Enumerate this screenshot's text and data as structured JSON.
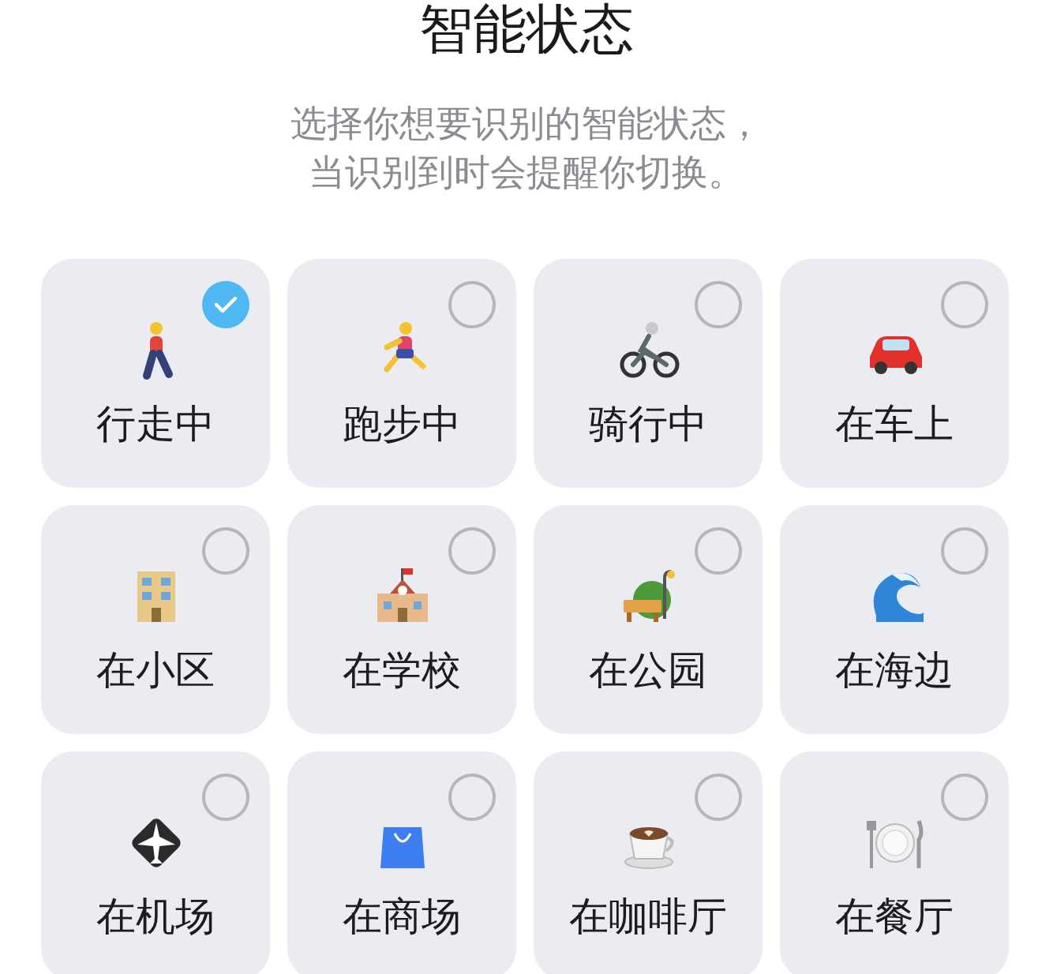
{
  "title": "智能状态",
  "subtitle": [
    "选择你想要识别的智能状态，",
    "当识别到时会提醒你切换。"
  ],
  "states": [
    {
      "label": "行走中",
      "selected": true
    },
    {
      "label": "跑步中",
      "selected": false
    },
    {
      "label": "骑行中",
      "selected": false
    },
    {
      "label": "在车上",
      "selected": false
    },
    {
      "label": "在小区",
      "selected": false
    },
    {
      "label": "在学校",
      "selected": false
    },
    {
      "label": "在公园",
      "selected": false
    },
    {
      "label": "在海边",
      "selected": false
    },
    {
      "label": "在机场",
      "selected": false
    },
    {
      "label": "在商场",
      "selected": false
    },
    {
      "label": "在咖啡厅",
      "selected": false
    },
    {
      "label": "在餐厅",
      "selected": false
    }
  ]
}
